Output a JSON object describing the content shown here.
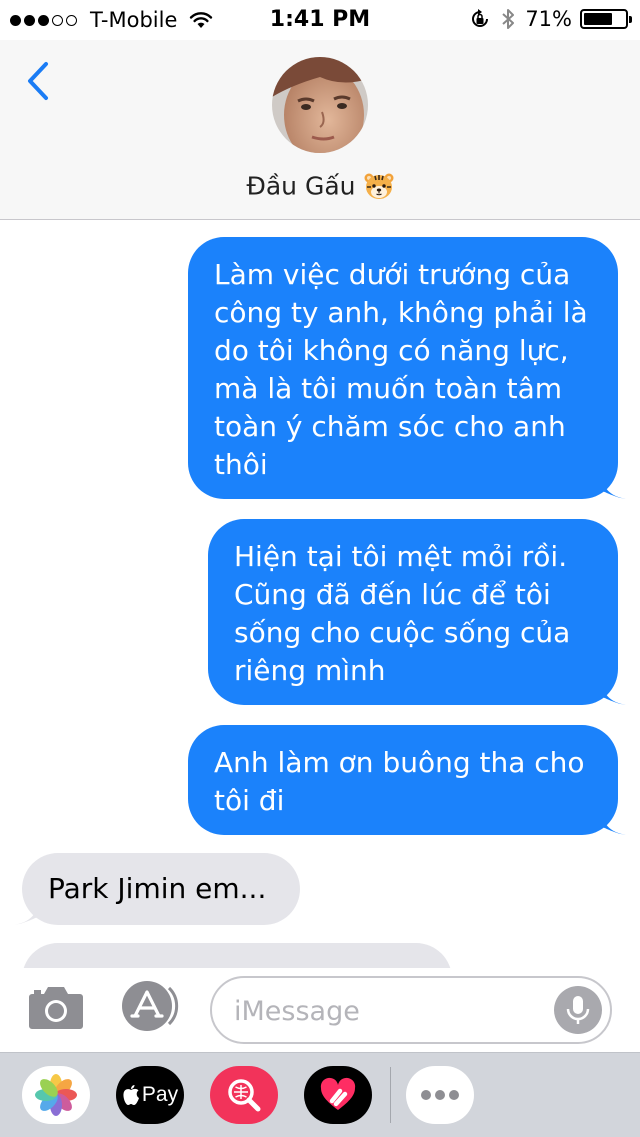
{
  "status_bar": {
    "carrier": "T-Mobile",
    "time": "1:41 PM",
    "battery_percent": "71%",
    "battery_level": 0.71,
    "signal_bars_filled": 3,
    "signal_bars_total": 5,
    "icons": [
      "wifi-icon",
      "rotation-lock-icon",
      "bluetooth-icon",
      "battery-icon"
    ]
  },
  "header": {
    "back_icon": "chevron-left-icon",
    "contact_name": "Đầu Gấu",
    "contact_emoji": "tiger-face-emoji"
  },
  "messages": [
    {
      "side": "sent",
      "text": "Làm việc dưới trướng của công ty anh, không phải là do tôi không có năng lực, mà là tôi muốn toàn tâm toàn ý chăm sóc cho anh thôi"
    },
    {
      "side": "sent",
      "text": "Hiện tại tôi mệt mỏi rồi. Cũng đã đến lúc để tôi sống cho cuộc sống của riêng mình"
    },
    {
      "side": "sent",
      "text": "Anh làm ơn buông tha cho tôi đi"
    },
    {
      "side": "received",
      "text": "Park Jimin em..."
    }
  ],
  "input_bar": {
    "placeholder": "iMessage",
    "camera_icon": "camera-icon",
    "app_store_icon": "app-store-icon",
    "mic_icon": "microphone-icon"
  },
  "app_drawer": {
    "apps": [
      "photos-icon",
      "apple-pay-icon",
      "search-images-icon",
      "digital-touch-icon",
      "more-icon"
    ],
    "apple_pay_label": "Pay"
  },
  "colors": {
    "sent_bubble": "#1b82fb",
    "received_bubble": "#e5e5ea",
    "accent": "#1a7cf5",
    "header_bg": "#f7f7f7",
    "drawer_bg": "#d2d5db"
  }
}
